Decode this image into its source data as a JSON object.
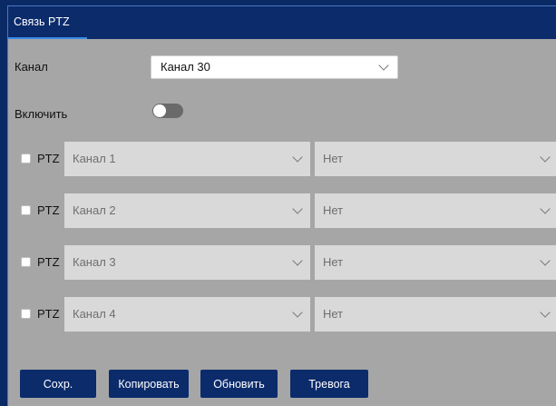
{
  "tab": {
    "title": "Связь PTZ"
  },
  "channel": {
    "label": "Канал",
    "value": "Канал 30"
  },
  "enable": {
    "label": "Включить",
    "on": false
  },
  "ptz_rows": [
    {
      "checked": false,
      "label": "PTZ",
      "channel": "Канал 1",
      "preset": "Нет"
    },
    {
      "checked": false,
      "label": "PTZ",
      "channel": "Канал 2",
      "preset": "Нет"
    },
    {
      "checked": false,
      "label": "PTZ",
      "channel": "Канал 3",
      "preset": "Нет"
    },
    {
      "checked": false,
      "label": "PTZ",
      "channel": "Канал 4",
      "preset": "Нет"
    }
  ],
  "buttons": {
    "save": "Сохр.",
    "copy": "Копировать",
    "refresh": "Обновить",
    "alarm": "Тревога"
  },
  "colors": {
    "header": "#0b2b6b",
    "accent": "#3a8ae8",
    "panel": "#a6a6a6",
    "toggle_off": "#6a6a6a"
  },
  "icons": {
    "dropdown": "chevron-down-icon"
  }
}
